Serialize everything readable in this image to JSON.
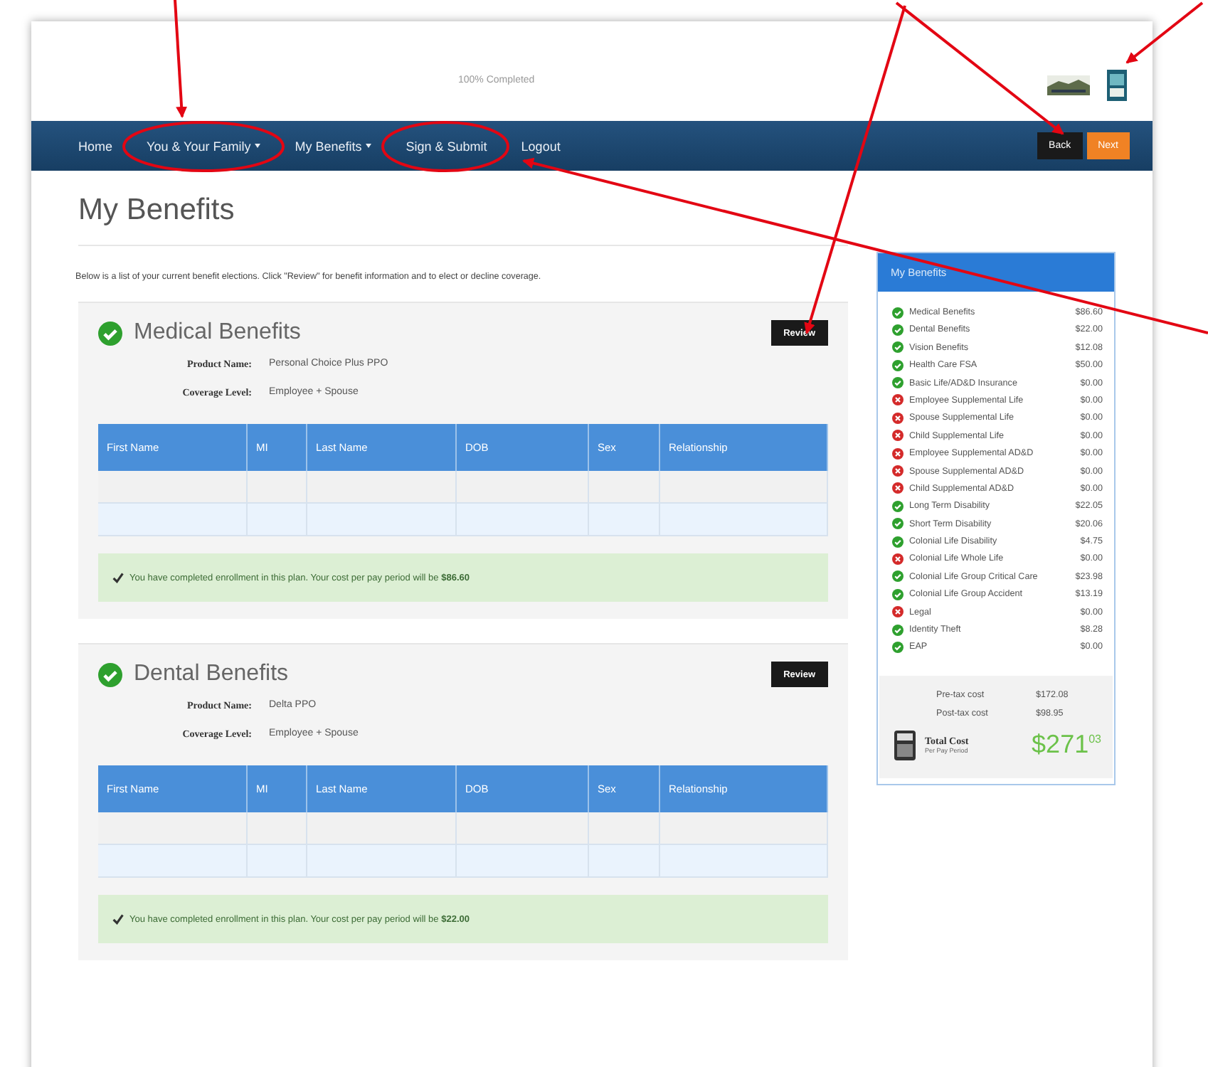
{
  "header": {
    "progress_text": "100% Completed"
  },
  "nav": {
    "items": [
      {
        "label": "Home",
        "has_menu": false
      },
      {
        "label": "You & Your Family",
        "has_menu": true
      },
      {
        "label": "My Benefits",
        "has_menu": true
      },
      {
        "label": "Sign & Submit",
        "has_menu": false
      },
      {
        "label": "Logout",
        "has_menu": false
      }
    ],
    "buttons": [
      {
        "label": "Back",
        "kind": "secondary"
      },
      {
        "label": "Next",
        "kind": "primary"
      }
    ]
  },
  "page_title": "My Benefits",
  "intro": "Below is a list of your current benefit elections.  Click \"Review\" for benefit information and to elect or decline coverage.",
  "benefits": [
    {
      "title": "Medical Benefits",
      "complete": true,
      "review_label": "Review",
      "product_label": "Product Name:",
      "product": "Personal Choice Plus PPO",
      "coverage_label": "Coverage Level:",
      "coverage": "Employee + Spouse",
      "columns": [
        "First Name",
        "MI",
        "Last Name",
        "DOB",
        "Sex",
        "Relationship"
      ],
      "message": "You have completed enrollment in this plan. Your cost per pay period will be **$86.60**"
    },
    {
      "title": "Dental Benefits",
      "complete": true,
      "review_label": "Review",
      "product_label": "Product Name:",
      "product": "Delta PPO",
      "coverage_label": "Coverage Level:",
      "coverage": "Employee + Spouse",
      "columns": [
        "First Name",
        "MI",
        "Last Name",
        "DOB",
        "Sex",
        "Relationship"
      ],
      "message": "You have completed enrollment in this plan. Your cost per pay period will be **$22.00**"
    }
  ],
  "summary": {
    "title": "My Benefits",
    "items": [
      {
        "name": "Medical Benefits",
        "amount": "$86.60",
        "enrolled": true
      },
      {
        "name": "Dental Benefits",
        "amount": "$22.00",
        "enrolled": true
      },
      {
        "name": "Vision Benefits",
        "amount": "$12.08",
        "enrolled": true
      },
      {
        "name": "Health Care FSA",
        "amount": "$50.00",
        "enrolled": true
      },
      {
        "name": "Basic Life/AD&D Insurance",
        "amount": "$0.00",
        "enrolled": true
      },
      {
        "name": "Employee Supplemental Life",
        "amount": "$0.00",
        "enrolled": false
      },
      {
        "name": "Spouse Supplemental Life",
        "amount": "$0.00",
        "enrolled": false
      },
      {
        "name": "Child Supplemental Life",
        "amount": "$0.00",
        "enrolled": false
      },
      {
        "name": "Employee Supplemental AD&D",
        "amount": "$0.00",
        "enrolled": false
      },
      {
        "name": "Spouse Supplemental AD&D",
        "amount": "$0.00",
        "enrolled": false
      },
      {
        "name": "Child Supplemental AD&D",
        "amount": "$0.00",
        "enrolled": false
      },
      {
        "name": "Long Term Disability",
        "amount": "$22.05",
        "enrolled": true
      },
      {
        "name": "Short Term Disability",
        "amount": "$20.06",
        "enrolled": true
      },
      {
        "name": "Colonial Life Disability",
        "amount": "$4.75",
        "enrolled": true
      },
      {
        "name": "Colonial Life Whole Life",
        "amount": "$0.00",
        "enrolled": false
      },
      {
        "name": "Colonial Life Group Critical Care",
        "amount": "$23.98",
        "enrolled": true
      },
      {
        "name": "Colonial Life Group Accident",
        "amount": "$13.19",
        "enrolled": true
      },
      {
        "name": "Legal",
        "amount": "$0.00",
        "enrolled": false
      },
      {
        "name": "Identity Theft",
        "amount": "$8.28",
        "enrolled": true
      },
      {
        "name": "EAP",
        "amount": "$0.00",
        "enrolled": true
      }
    ],
    "pretax_label": "Pre-tax cost",
    "pretax": "$172.08",
    "posttax_label": "Post-tax cost",
    "posttax": "$98.95",
    "total_label": "Total Cost",
    "total_sub": "Per Pay Period",
    "total": "$271$^{03}$"
  }
}
